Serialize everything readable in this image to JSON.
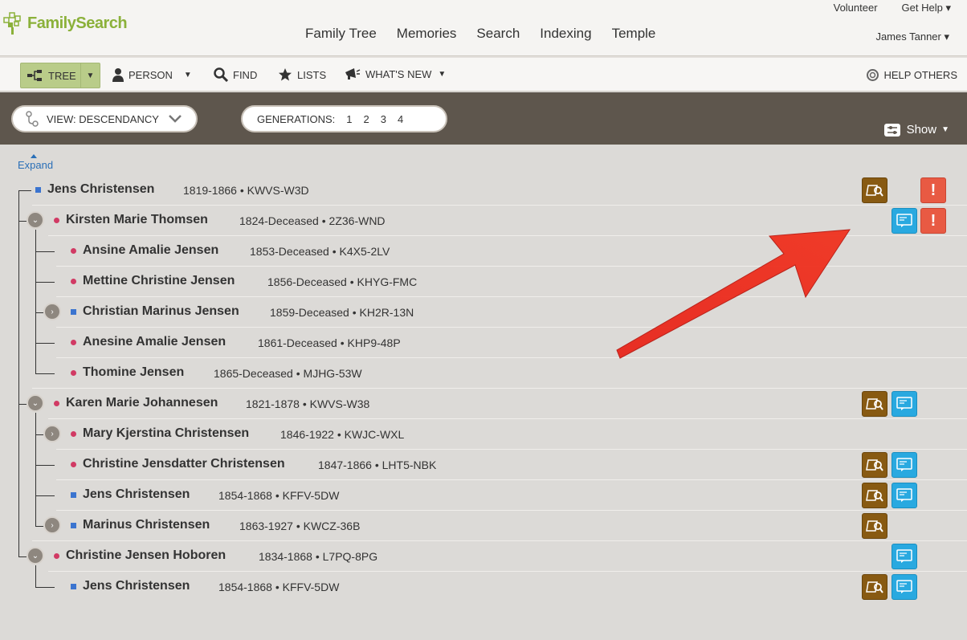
{
  "header": {
    "logo_text": "FamilySearch",
    "nav": [
      "Family Tree",
      "Memories",
      "Search",
      "Indexing",
      "Temple"
    ],
    "volunteer": "Volunteer",
    "get_help": "Get Help ▾",
    "user": "James Tanner ▾"
  },
  "toolbar": {
    "tree": "TREE",
    "person": "PERSON",
    "find": "FIND",
    "lists": "LISTS",
    "whats_new": "WHAT'S NEW",
    "help_others": "HELP OTHERS"
  },
  "band": {
    "view_label": "VIEW: DESCENDANCY",
    "generations_label": "GENERATIONS:",
    "generations": [
      "1",
      "2",
      "3",
      "4"
    ],
    "show": "Show"
  },
  "expand_label": "Expand",
  "rows": [
    {
      "name": "Jens Christensen",
      "life": "1819-1866 • KWVS-W3D",
      "sex": "m"
    },
    {
      "name": "Kirsten Marie Thomsen",
      "life": "1824-Deceased • 2Z36-WND",
      "sex": "f"
    },
    {
      "name": "Ansine Amalie Jensen",
      "life": "1853-Deceased • K4X5-2LV",
      "sex": "f"
    },
    {
      "name": "Mettine Christine Jensen",
      "life": "1856-Deceased • KHYG-FMC",
      "sex": "f"
    },
    {
      "name": "Christian Marinus Jensen",
      "life": "1859-Deceased • KH2R-13N",
      "sex": "m"
    },
    {
      "name": "Anesine Amalie Jensen",
      "life": "1861-Deceased • KHP9-48P",
      "sex": "f"
    },
    {
      "name": "Thomine Jensen",
      "life": "1865-Deceased • MJHG-53W",
      "sex": "f"
    },
    {
      "name": "Karen Marie Johannesen",
      "life": "1821-1878 • KWVS-W38",
      "sex": "f"
    },
    {
      "name": "Mary Kjerstina Christensen",
      "life": "1846-1922 • KWJC-WXL",
      "sex": "f"
    },
    {
      "name": "Christine Jensdatter Christensen",
      "life": "1847-1866 • LHT5-NBK",
      "sex": "f"
    },
    {
      "name": "Jens Christensen",
      "life": "1854-1868 • KFFV-5DW",
      "sex": "m"
    },
    {
      "name": "Marinus Christensen",
      "life": "1863-1927 • KWCZ-36B",
      "sex": "m"
    },
    {
      "name": "Christine Jensen Hoboren",
      "life": "1834-1868 • L7PQ-8PG",
      "sex": "f"
    },
    {
      "name": "Jens Christensen",
      "life": "1854-1868 • KFFV-5DW",
      "sex": "m"
    }
  ],
  "colors": {
    "accent_green": "#8bb13a",
    "band": "#5e564d",
    "research_icon": "#885a12",
    "discussion_icon": "#29a9e0",
    "alert_icon": "#e85a43",
    "arrow": "#e8251b"
  }
}
